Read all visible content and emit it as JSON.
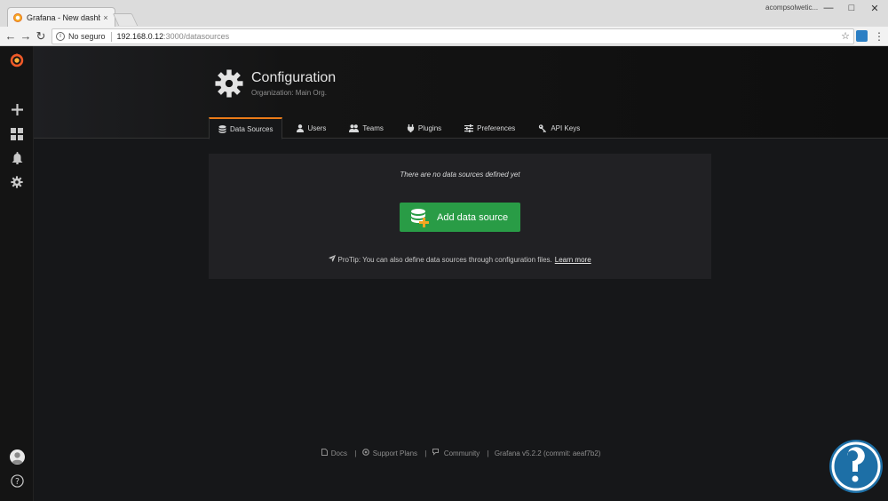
{
  "browser": {
    "tab_title": "Grafana - New dashboard",
    "tab_close": "×",
    "profile": "acompsolwetic...",
    "security_label": "No seguro",
    "url_host": "192.168.0.12",
    "url_path": ":3000/datasources"
  },
  "page": {
    "title": "Configuration",
    "subtitle": "Organization: Main Org."
  },
  "tabs": [
    {
      "label": "Data Sources",
      "icon": "database-icon",
      "active": true
    },
    {
      "label": "Users",
      "icon": "user-icon",
      "active": false
    },
    {
      "label": "Teams",
      "icon": "users-icon",
      "active": false
    },
    {
      "label": "Plugins",
      "icon": "plug-icon",
      "active": false
    },
    {
      "label": "Preferences",
      "icon": "sliders-icon",
      "active": false
    },
    {
      "label": "API Keys",
      "icon": "key-icon",
      "active": false
    }
  ],
  "empty": {
    "message": "There are no data sources defined yet",
    "button_label": "Add data source",
    "protip": "ProTip: You can also define data sources through configuration files.",
    "learn_more": "Learn more"
  },
  "footer": {
    "docs": "Docs",
    "support": "Support Plans",
    "community": "Community",
    "version": "Grafana v5.2.2 (commit: aeaf7b2)",
    "sep": "|"
  },
  "colors": {
    "accent": "#eb7b18",
    "primary_button": "#299c46",
    "background": "#161719",
    "panel": "#212124"
  }
}
